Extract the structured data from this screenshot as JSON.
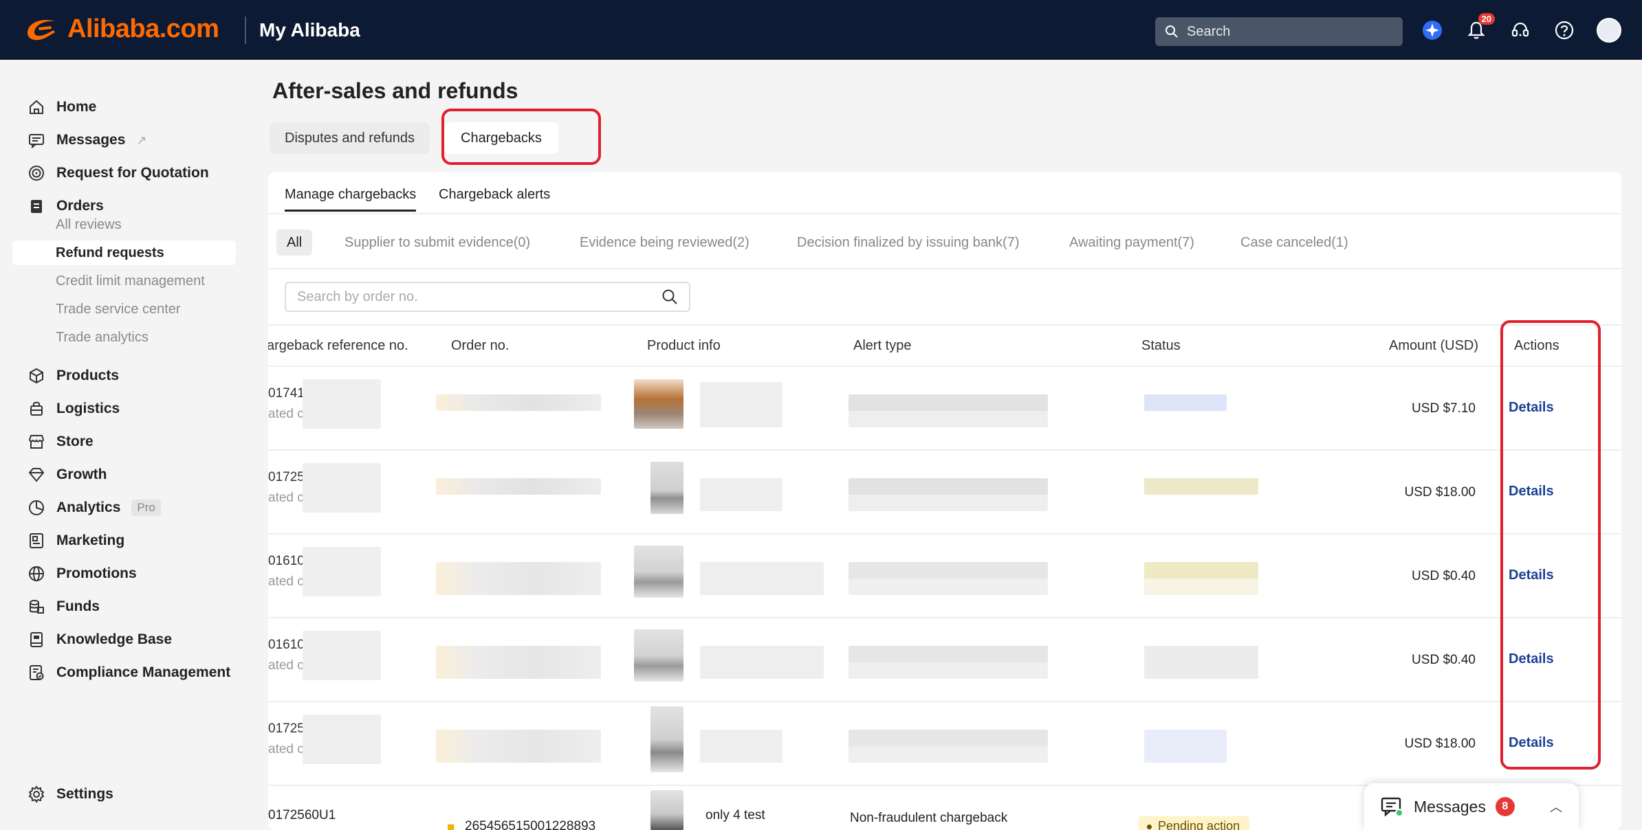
{
  "header": {
    "brand": "Alibaba.com",
    "section": "My Alibaba",
    "search_placeholder": "Search",
    "notification_count": "20"
  },
  "sidebar": {
    "items": [
      {
        "label": "Home",
        "icon": "home-icon"
      },
      {
        "label": "Messages",
        "icon": "messages-icon",
        "external": "↗"
      },
      {
        "label": "Request for Quotation",
        "icon": "target-icon"
      },
      {
        "label": "Orders",
        "icon": "orders-icon"
      },
      {
        "label": "Products",
        "icon": "box-icon"
      },
      {
        "label": "Logistics",
        "icon": "logistics-icon"
      },
      {
        "label": "Store",
        "icon": "store-icon"
      },
      {
        "label": "Growth",
        "icon": "growth-icon"
      },
      {
        "label": "Analytics",
        "icon": "analytics-icon",
        "badge": "Pro"
      },
      {
        "label": "Marketing",
        "icon": "marketing-icon"
      },
      {
        "label": "Promotions",
        "icon": "promotions-icon"
      },
      {
        "label": "Funds",
        "icon": "funds-icon"
      },
      {
        "label": "Knowledge Base",
        "icon": "knowledge-icon"
      },
      {
        "label": "Compliance Management",
        "icon": "compliance-icon"
      }
    ],
    "order_subitems": [
      "All reviews",
      "Refund requests",
      "Credit limit management",
      "Trade service center",
      "Trade analytics"
    ],
    "settings_label": "Settings"
  },
  "main": {
    "title": "After-sales and refunds",
    "tabs": [
      "Disputes and refunds",
      "Chargebacks"
    ],
    "subtabs": [
      "Manage chargebacks",
      "Chargeback alerts"
    ],
    "filters": [
      "All",
      "Supplier to submit evidence(0)",
      "Evidence being reviewed(2)",
      "Decision finalized by issuing bank(7)",
      "Awaiting payment(7)",
      "Case canceled(1)"
    ],
    "order_search_placeholder": "Search by order no.",
    "columns": [
      "argeback reference no.",
      "Order no.",
      "Product info",
      "Alert type",
      "Status",
      "Amount (USD)",
      "Actions"
    ],
    "rows": [
      {
        "ref": "01741:",
        "ref_sub": "ated c",
        "amount": "USD $7.10",
        "action": "Details"
      },
      {
        "ref": "01725",
        "ref_sub": "ated c",
        "amount": "USD $18.00",
        "action": "Details"
      },
      {
        "ref": "01610",
        "ref_sub": "ated c",
        "amount": "USD $0.40",
        "action": "Details"
      },
      {
        "ref": "01610",
        "ref_sub": "ated c",
        "amount": "USD $0.40",
        "action": "Details"
      },
      {
        "ref": "01725",
        "ref_sub": "ated c",
        "amount": "USD $18.00",
        "action": "Details"
      }
    ],
    "last_row": {
      "ref": "0172560U1",
      "order": "265456515001228893",
      "product": "only 4 test",
      "alert": "Non-fraudulent chargeback",
      "status": "Pending action"
    }
  },
  "messages_widget": {
    "label": "Messages",
    "count": "8"
  },
  "colors": {
    "brand": "#ff6a00",
    "header_bg": "#0d1a33",
    "highlight": "#e0202e",
    "link": "#1c3f94"
  }
}
